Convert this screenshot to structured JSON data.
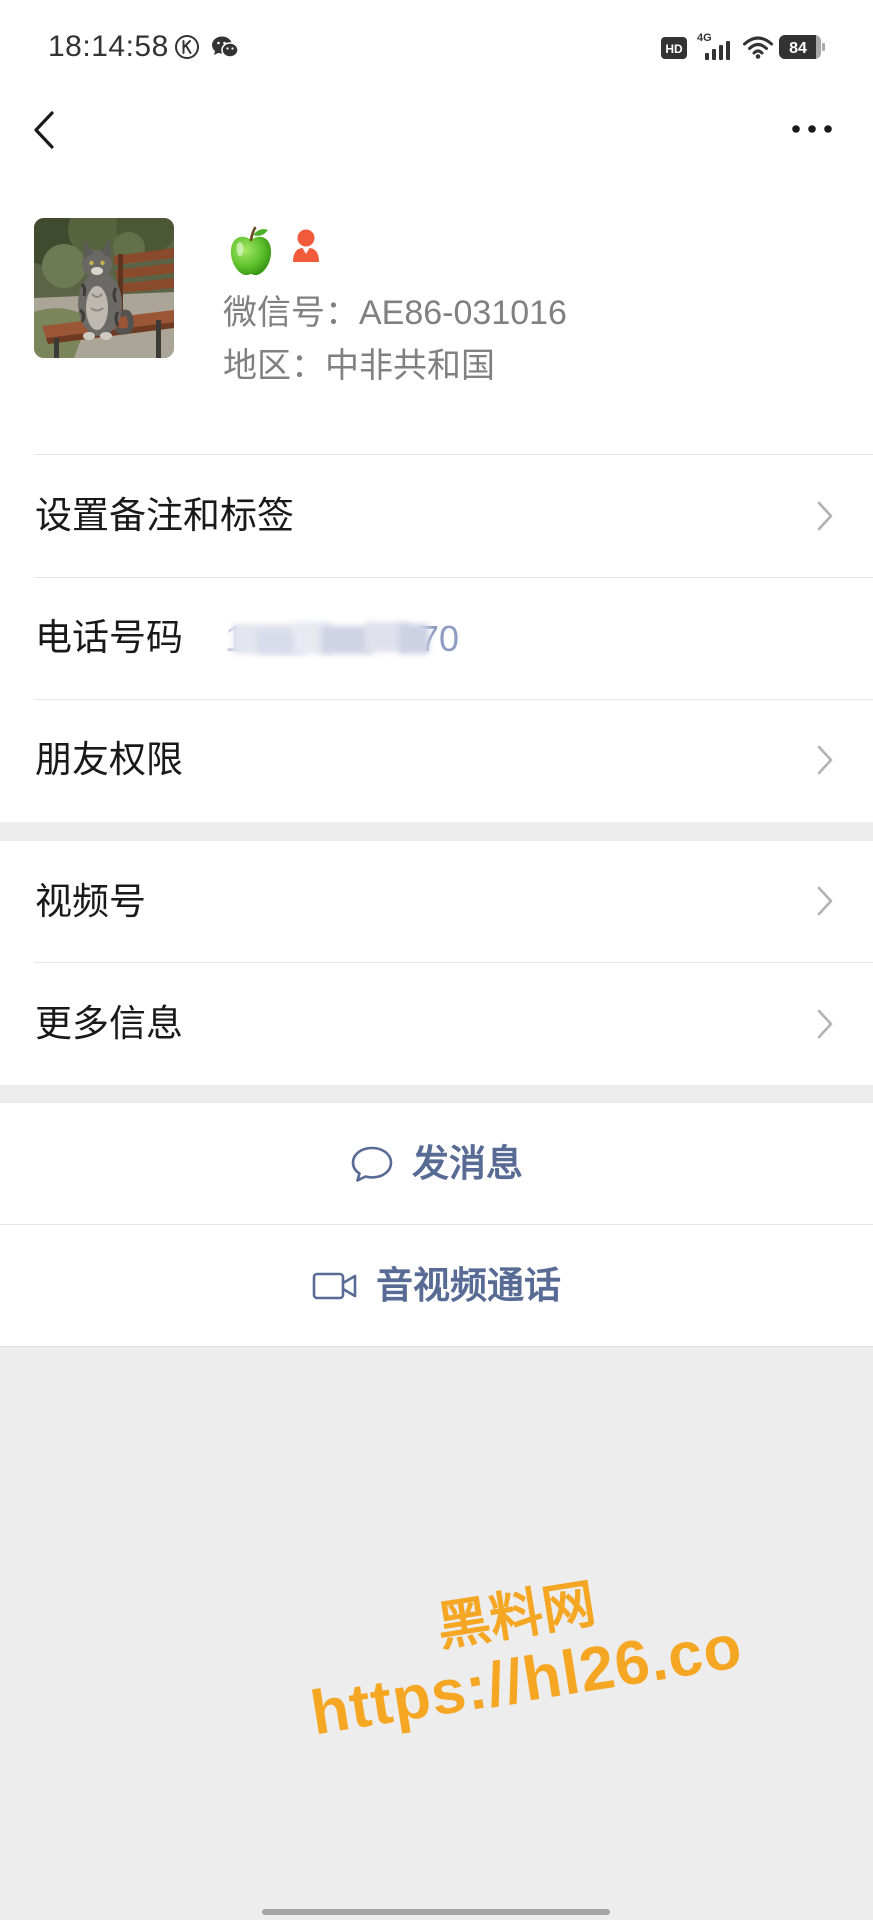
{
  "status_bar": {
    "time": "18:14:58",
    "left_icons": [
      "k-circle-icon",
      "wechat-icon"
    ],
    "hd_label": "HD",
    "network_label": "4G",
    "battery_level": "84",
    "right_icons": [
      "hd-icon",
      "cellular-signal-icon",
      "wifi-icon",
      "battery-icon"
    ]
  },
  "nav": {
    "back_icon": "chevron-left-icon",
    "more_icon": "more-dots-icon"
  },
  "profile": {
    "badges": [
      "green-apple-icon",
      "person-icon"
    ],
    "wechat_id_label": "微信号：",
    "wechat_id": "AE86-031016",
    "region_label": "地区：",
    "region": "中非共和国"
  },
  "sections": [
    {
      "items": [
        {
          "label": "设置备注和标签",
          "chevron": true
        },
        {
          "label": "电话号码",
          "value_start": "1",
          "value_end": "70",
          "value_masked": true,
          "chevron": false
        },
        {
          "label": "朋友权限",
          "chevron": true
        }
      ]
    },
    {
      "items": [
        {
          "label": "视频号",
          "chevron": true
        },
        {
          "label": "更多信息",
          "chevron": true
        }
      ]
    }
  ],
  "actions": [
    {
      "label": "发消息",
      "icon": "chat-bubble-icon"
    },
    {
      "label": "音视频通话",
      "icon": "video-camera-icon"
    }
  ],
  "watermark": {
    "line1": "黑料网",
    "line2": "https://hl26.co"
  },
  "colors": {
    "text_primary": "#191919",
    "text_secondary": "#808080",
    "link": "#576b95",
    "page_background": "#ededed",
    "card_background": "#ffffff",
    "divider": "#e5e5e5",
    "chevron": "#b2b2b2",
    "watermark": "#f5a623",
    "badge_red": "#f15a3b",
    "apple_green": "#5cbf2a"
  }
}
